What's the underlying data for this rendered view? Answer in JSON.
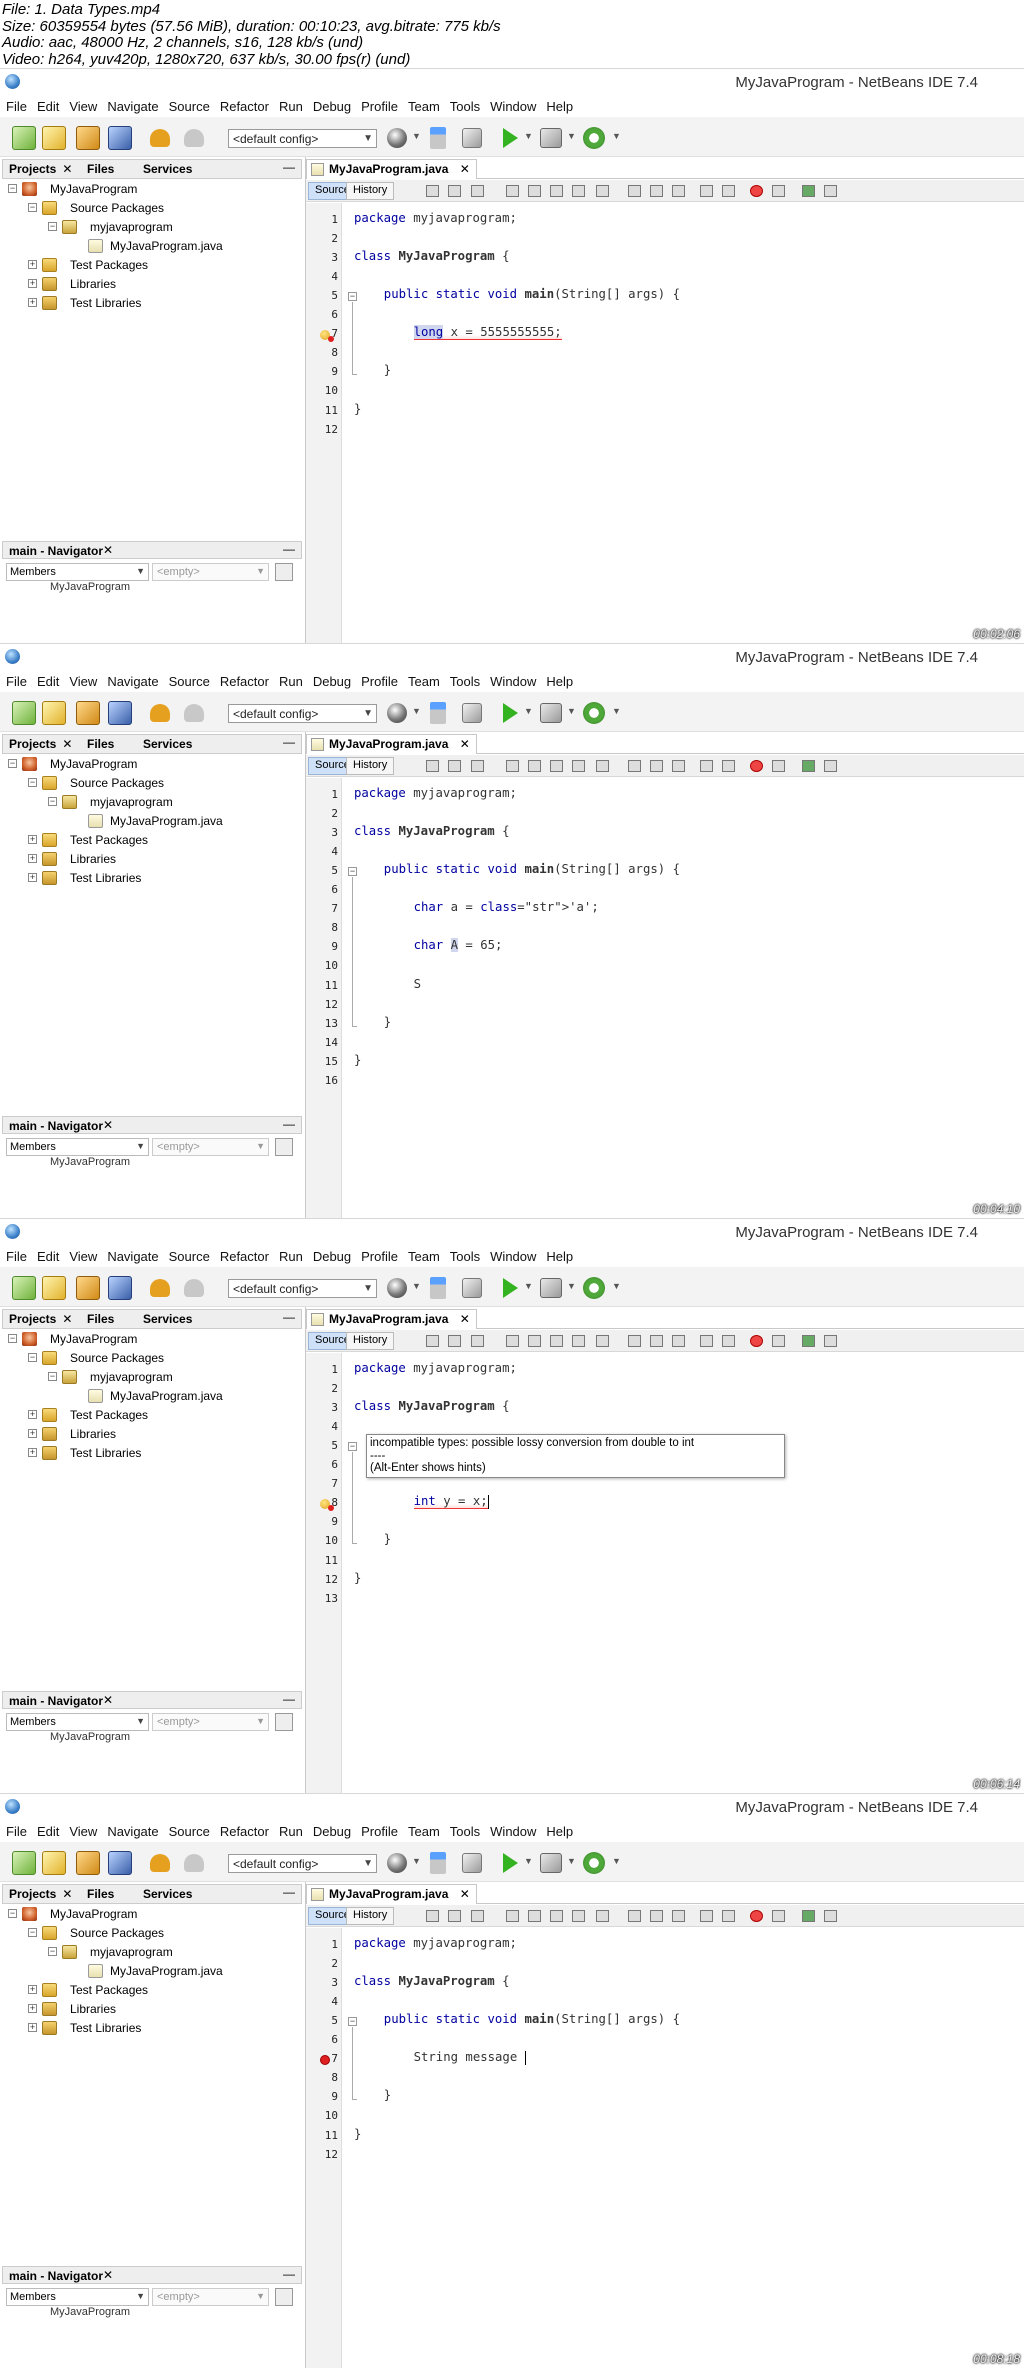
{
  "meta": {
    "lines": [
      "File: 1. Data Types.mp4",
      "Size: 60359554 bytes (57.56 MiB), duration: 00:10:23, avg.bitrate: 775 kb/s",
      "Audio: aac, 48000 Hz, 2 channels, s16, 128 kb/s (und)",
      "Video: h264, yuv420p, 1280x720, 637 kb/s, 30.00 fps(r) (und)"
    ]
  },
  "ide": {
    "title": "MyJavaProgram - NetBeans IDE 7.4",
    "menu": [
      "File",
      "Edit",
      "View",
      "Navigate",
      "Source",
      "Refactor",
      "Run",
      "Debug",
      "Profile",
      "Team",
      "Tools",
      "Window",
      "Help"
    ],
    "config": "<default config>",
    "panel_tabs": [
      "Projects",
      "Files",
      "Services"
    ],
    "tree": [
      "MyJavaProgram",
      "Source Packages",
      "myjavaprogram",
      "MyJavaProgram.java",
      "Test Packages",
      "Libraries",
      "Test Libraries"
    ],
    "navigator_title": "main - Navigator",
    "members": "Members",
    "empty": "<empty>",
    "navigator_cut": "MyJavaProgram",
    "editor_tab": "MyJavaProgram.java",
    "source_btn": "Source",
    "history_btn": "History",
    "close_glyph": "✕",
    "minimize_glyph": "—"
  },
  "frames": [
    {
      "timestamp": "00:02:06",
      "line_count": 12,
      "lines": {
        "1": "package myjavaprogram;",
        "3": "class MyJavaProgram {",
        "5": "public static void main(String[] args) {",
        "7": "long x = 5555555555;",
        "9": "}",
        "11": "}"
      }
    },
    {
      "timestamp": "00:04:10",
      "line_count": 16,
      "lines": {
        "1": "package myjavaprogram;",
        "3": "class MyJavaProgram {",
        "5": "public static void main(String[] args) {",
        "7": "char a = 'a';",
        "9": "char A = 65;",
        "11": "S",
        "13": "}",
        "15": "}"
      }
    },
    {
      "timestamp": "00:06:14",
      "line_count": 13,
      "lines": {
        "1": "package myjavaprogram;",
        "3": "class MyJavaProgram {",
        "8": "int y = x;",
        "10": "}",
        "12": "}"
      },
      "tooltip": {
        "message": "incompatible types: possible lossy conversion from double to int",
        "separator": "----",
        "hint": "(Alt-Enter shows hints)"
      }
    },
    {
      "timestamp": "00:08:18",
      "line_count": 12,
      "lines": {
        "1": "package myjavaprogram;",
        "3": "class MyJavaProgram {",
        "5": "public static void main(String[] args) {",
        "7": "String message ",
        "9": "}",
        "11": "}"
      }
    }
  ]
}
